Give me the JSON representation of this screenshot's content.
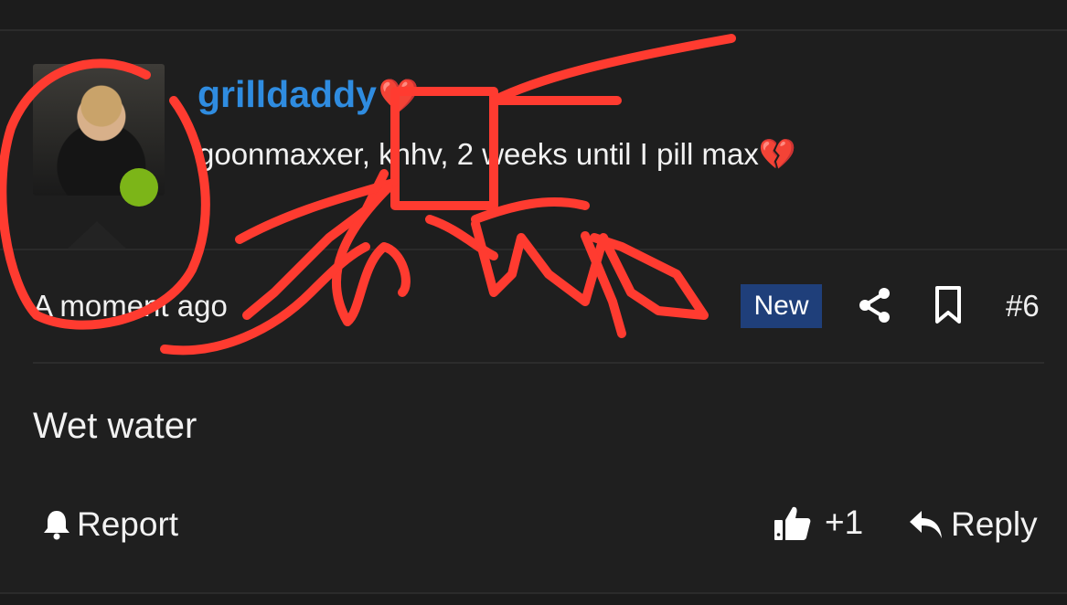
{
  "post": {
    "username": "grilldaddy",
    "username_emoji": "❤️",
    "user_title": "goonmaxxer, khhv, 2 weeks until I pill max",
    "user_title_emoji": "💔",
    "timestamp": "A moment ago",
    "badge": "New",
    "post_number": "#6",
    "content": "Wet water",
    "online_status_color": "#7cb518"
  },
  "actions": {
    "report_label": "Report",
    "like_count": "+1",
    "reply_label": "Reply"
  },
  "icons": {
    "report": "bell-icon",
    "like": "thumbs-up-icon",
    "reply": "reply-arrow-icon",
    "share": "share-icon",
    "bookmark": "bookmark-icon"
  },
  "colors": {
    "username": "#2f8ce0",
    "badge_bg": "#1f3f7a",
    "annotation": "#ff3b30"
  }
}
